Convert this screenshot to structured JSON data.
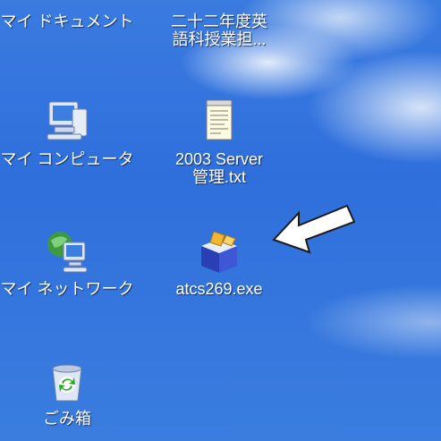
{
  "desktop": {
    "icons": [
      {
        "label": "マイ ドキュメント",
        "icon": "folder-documents-icon"
      },
      {
        "label": "二十二年度英\n語科授業担...",
        "icon": "document-icon"
      },
      {
        "label": "マイ コンピュータ",
        "icon": "computer-icon"
      },
      {
        "label": "2003 Server\n管理.txt",
        "icon": "text-file-icon"
      },
      {
        "label": "マイ ネットワーク",
        "icon": "network-icon"
      },
      {
        "label": "atcs269.exe",
        "icon": "installer-box-icon"
      },
      {
        "label": "ごみ箱",
        "icon": "recycle-bin-icon"
      }
    ],
    "annotation": {
      "icon": "arrow-icon",
      "color": "#ffffff"
    }
  }
}
